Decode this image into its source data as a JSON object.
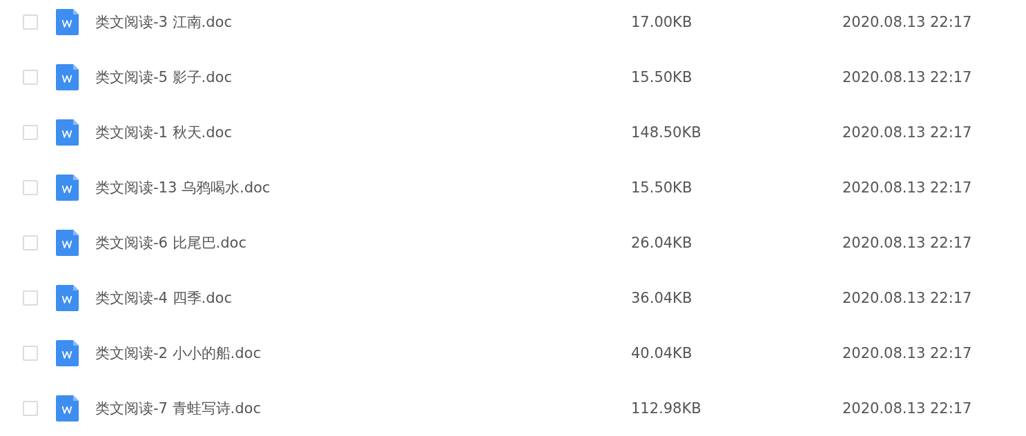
{
  "files": [
    {
      "name": "类文阅读-3 江南.doc",
      "size": "17.00KB",
      "modified": "2020.08.13 22:17",
      "checked": false
    },
    {
      "name": "类文阅读-5 影子.doc",
      "size": "15.50KB",
      "modified": "2020.08.13 22:17",
      "checked": false
    },
    {
      "name": "类文阅读-1 秋天.doc",
      "size": "148.50KB",
      "modified": "2020.08.13 22:17",
      "checked": false
    },
    {
      "name": "类文阅读-13 乌鸦喝水.doc",
      "size": "15.50KB",
      "modified": "2020.08.13 22:17",
      "checked": false
    },
    {
      "name": "类文阅读-6 比尾巴.doc",
      "size": "26.04KB",
      "modified": "2020.08.13 22:17",
      "checked": false
    },
    {
      "name": "类文阅读-4 四季.doc",
      "size": "36.04KB",
      "modified": "2020.08.13 22:17",
      "checked": false
    },
    {
      "name": "类文阅读-2 小小的船.doc",
      "size": "40.04KB",
      "modified": "2020.08.13 22:17",
      "checked": false
    },
    {
      "name": "类文阅读-7 青蛙写诗.doc",
      "size": "112.98KB",
      "modified": "2020.08.13 22:17",
      "checked": false
    }
  ]
}
